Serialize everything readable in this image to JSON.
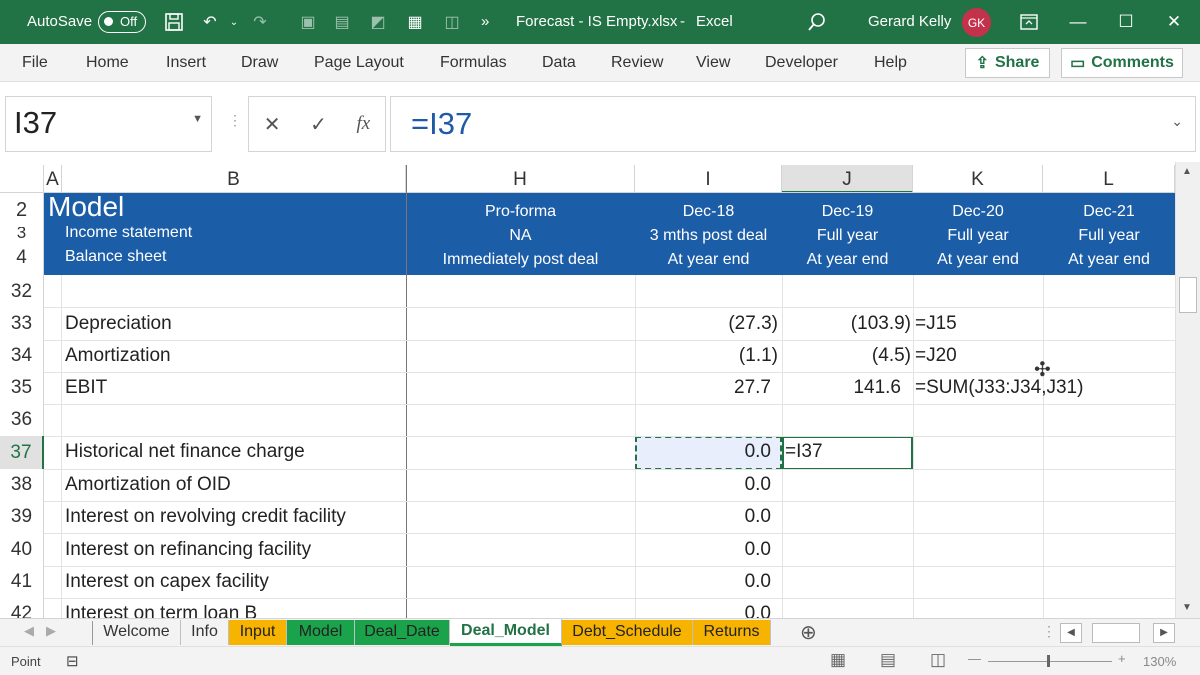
{
  "titlebar": {
    "autosave_label": "AutoSave",
    "autosave_state": "Off",
    "overflow": "»",
    "filename": "Forecast - IS Empty.xlsx",
    "sep": "-",
    "app": "Excel",
    "user": "Gerard Kelly",
    "initials": "GK"
  },
  "menu": {
    "items": [
      "File",
      "Home",
      "Insert",
      "Draw",
      "Page Layout",
      "Formulas",
      "Data",
      "Review",
      "View",
      "Developer",
      "Help"
    ],
    "share": "Share",
    "comments": "Comments"
  },
  "formula_bar": {
    "namebox": "I37",
    "formula": "=I37",
    "fx": "fx"
  },
  "columns": {
    "A": "A",
    "B": "B",
    "H": "H",
    "I": "I",
    "J": "J",
    "K": "K",
    "L": "L"
  },
  "header_block": {
    "row_labels": [
      "2",
      "3",
      "4"
    ],
    "title": "Model",
    "sub1": "Income statement",
    "sub2": "Balance sheet",
    "H": [
      "Pro-forma",
      "NA",
      "Immediately post deal"
    ],
    "I": [
      "Dec-18",
      "3 mths post deal",
      "At year end"
    ],
    "J": [
      "Dec-19",
      "Full year",
      "At year end"
    ],
    "K": [
      "Dec-20",
      "Full year",
      "At year end"
    ],
    "L": [
      "Dec-21",
      "Full year",
      "At year end"
    ]
  },
  "rows": [
    {
      "num": "32",
      "label": "",
      "I": "",
      "J": "",
      "K": ""
    },
    {
      "num": "33",
      "label": "Depreciation",
      "I": "(27.3)",
      "J": "(103.9)",
      "K": "=J15"
    },
    {
      "num": "34",
      "label": "Amortization",
      "I": "(1.1)",
      "J": "(4.5)",
      "K": "=J20"
    },
    {
      "num": "35",
      "label": "EBIT",
      "I": "27.7",
      "J": "141.6",
      "K": "=SUM(J33:J34,J31)"
    },
    {
      "num": "36",
      "label": "",
      "I": "",
      "J": "",
      "K": ""
    },
    {
      "num": "37",
      "label": "Historical net finance charge",
      "I": "0.0",
      "J": "=I37",
      "K": ""
    },
    {
      "num": "38",
      "label": "Amortization of OID",
      "I": "0.0",
      "J": "",
      "K": ""
    },
    {
      "num": "39",
      "label": "Interest on revolving credit facility",
      "I": "0.0",
      "J": "",
      "K": ""
    },
    {
      "num": "40",
      "label": "Interest on refinancing facility",
      "I": "0.0",
      "J": "",
      "K": ""
    },
    {
      "num": "41",
      "label": "Interest on capex facility",
      "I": "0.0",
      "J": "",
      "K": ""
    },
    {
      "num": "42",
      "label": "Interest on term loan B",
      "I": "0.0",
      "J": "",
      "K": ""
    }
  ],
  "sheets": [
    {
      "name": "Welcome",
      "color": "#f3f3f3",
      "text": "#333"
    },
    {
      "name": "Info",
      "color": "#f3f3f3",
      "text": "#333"
    },
    {
      "name": "Input",
      "color": "#f6b300",
      "text": "#222"
    },
    {
      "name": "Model",
      "color": "#1aa34a",
      "text": "#111"
    },
    {
      "name": "Deal_Date",
      "color": "#1aa34a",
      "text": "#111"
    },
    {
      "name": "Deal_Model",
      "color": "#ffffff",
      "text": "#217346",
      "active": true
    },
    {
      "name": "Debt_Schedule",
      "color": "#f6b300",
      "text": "#222"
    },
    {
      "name": "Returns",
      "color": "#f6b300",
      "text": "#222"
    }
  ],
  "status": {
    "mode": "Point",
    "zoom": "130%"
  },
  "colors": {
    "excel_green": "#217346",
    "header_blue": "#1c5da8"
  }
}
